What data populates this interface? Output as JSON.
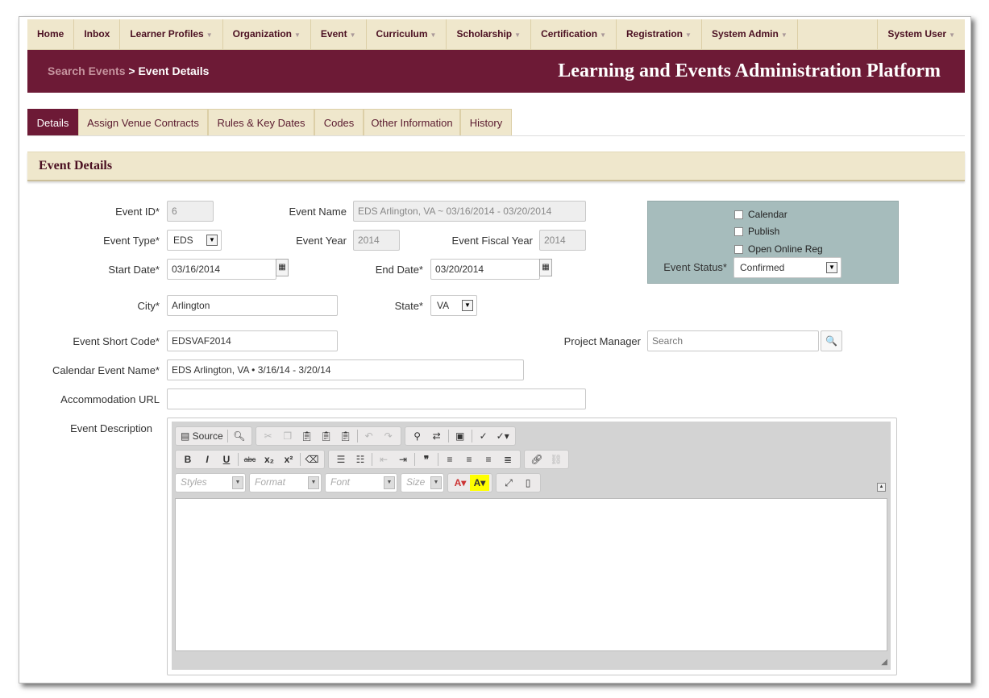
{
  "nav": {
    "items": [
      {
        "label": "Home",
        "dropdown": false
      },
      {
        "label": "Inbox",
        "dropdown": false
      },
      {
        "label": "Learner Profiles",
        "dropdown": true
      },
      {
        "label": "Organization",
        "dropdown": true
      },
      {
        "label": "Event",
        "dropdown": true
      },
      {
        "label": "Curriculum",
        "dropdown": true
      },
      {
        "label": "Scholarship",
        "dropdown": true
      },
      {
        "label": "Certification",
        "dropdown": true
      },
      {
        "label": "Registration",
        "dropdown": true
      },
      {
        "label": "System Admin",
        "dropdown": true
      }
    ],
    "user": "System User"
  },
  "breadcrumb": {
    "link": "Search Events",
    "separator": ">",
    "current": "Event Details"
  },
  "app_title": "Learning and Events Administration Platform",
  "tabs": [
    "Details",
    "Assign Venue Contracts",
    "Rules & Key Dates",
    "Codes",
    "Other Information",
    "History"
  ],
  "section_title": "Event Details",
  "form": {
    "event_id": {
      "label": "Event ID*",
      "value": "6"
    },
    "event_name": {
      "label": "Event Name",
      "value": "EDS Arlington, VA ~ 03/16/2014 - 03/20/2014"
    },
    "event_type": {
      "label": "Event Type*",
      "value": "EDS"
    },
    "event_year": {
      "label": "Event Year",
      "value": "2014"
    },
    "event_fiscal_year": {
      "label": "Event Fiscal Year",
      "value": "2014"
    },
    "start_date": {
      "label": "Start Date*",
      "value": "03/16/2014"
    },
    "end_date": {
      "label": "End Date*",
      "value": "03/20/2014"
    },
    "city": {
      "label": "City*",
      "value": "Arlington"
    },
    "state": {
      "label": "State*",
      "value": "VA"
    },
    "short_code": {
      "label": "Event Short Code*",
      "value": "EDSVAF2014"
    },
    "project_manager": {
      "label": "Project Manager",
      "placeholder": "Search"
    },
    "calendar_name": {
      "label": "Calendar Event Name*",
      "value": "EDS Arlington, VA • 3/16/14 - 3/20/14"
    },
    "accommodation_url": {
      "label": "Accommodation URL",
      "value": ""
    },
    "description": {
      "label": "Event Description"
    }
  },
  "status_box": {
    "checkboxes": [
      "Calendar",
      "Publish",
      "Open Online Reg"
    ],
    "status_label": "Event Status*",
    "status_value": "Confirmed"
  },
  "editor": {
    "source_label": "Source",
    "combos": [
      "Styles",
      "Format",
      "Font",
      "Size"
    ]
  },
  "colors": {
    "brand": "#6d1a36",
    "nav_bg": "#efe7cc",
    "status_box": "#a6bcbc"
  }
}
